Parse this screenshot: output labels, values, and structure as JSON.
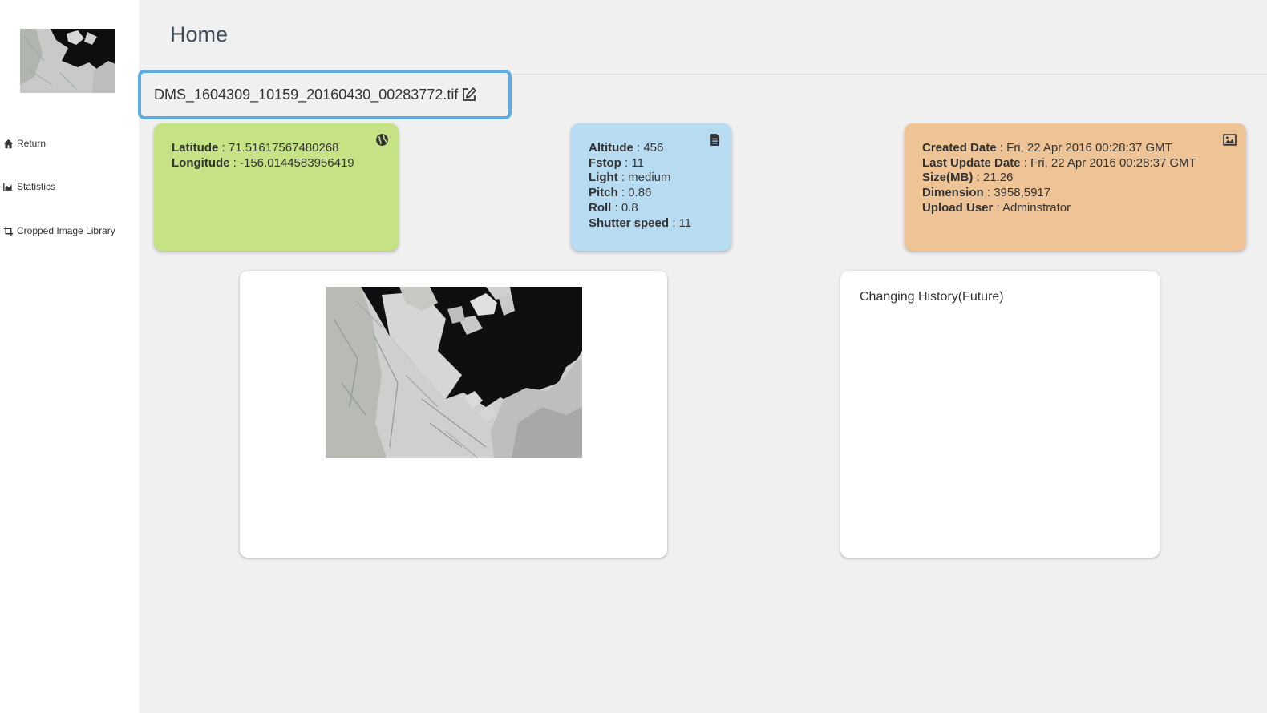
{
  "sidebar": {
    "logo_alt": "thumbnail",
    "items": [
      {
        "label": "Return",
        "icon": "home-icon"
      },
      {
        "label": "Statistics",
        "icon": "area-chart-icon"
      },
      {
        "label": "Cropped Image Library",
        "icon": "crop-icon"
      }
    ]
  },
  "header": {
    "title": "Home"
  },
  "file": {
    "name": "DMS_1604309_10159_20160430_00283772.tif",
    "edit_icon": "edit-icon"
  },
  "location_card": {
    "color": "#c5e385",
    "icon": "globe-icon",
    "fields": [
      {
        "label": "Latitude",
        "value": "71.51617567480268"
      },
      {
        "label": "Longitude",
        "value": "-156.0144583956419"
      }
    ]
  },
  "camera_card": {
    "color": "#b7dcf2",
    "icon": "document-icon",
    "fields": [
      {
        "label": "Altitude",
        "value": "456"
      },
      {
        "label": "Fstop",
        "value": "11"
      },
      {
        "label": "Light",
        "value": "medium"
      },
      {
        "label": "Pitch",
        "value": "0.86"
      },
      {
        "label": "Roll",
        "value": "0.8"
      },
      {
        "label": "Shutter speed",
        "value": "11"
      }
    ]
  },
  "file_card": {
    "color": "#eec497",
    "icon": "image-icon",
    "fields": [
      {
        "label": "Created Date",
        "value": "Fri, 22 Apr 2016 00:28:37 GMT"
      },
      {
        "label": "Last Update Date",
        "value": "Fri, 22 Apr 2016 00:28:37 GMT"
      },
      {
        "label": "Size(MB)",
        "value": "21.26"
      },
      {
        "label": "Dimension",
        "value": "3958,5917"
      },
      {
        "label": "Upload User",
        "value": "Adminstrator"
      }
    ]
  },
  "history": {
    "title": "Changing History(Future)"
  }
}
